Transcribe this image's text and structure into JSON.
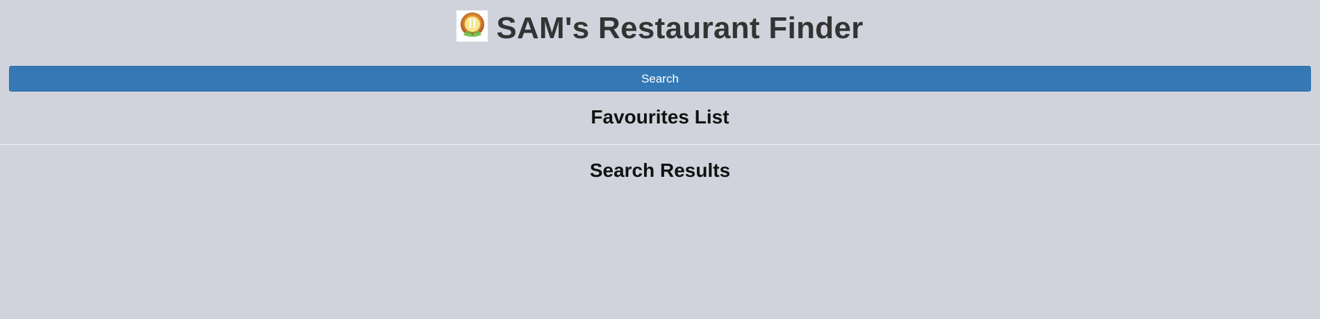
{
  "app": {
    "title": "SAM's Restaurant Finder",
    "logo_icon": "restaurant-logo-icon"
  },
  "search": {
    "button_label": "Search"
  },
  "sections": {
    "favourites_heading": "Favourites List",
    "results_heading": "Search Results"
  },
  "colors": {
    "background": "#d0d3db",
    "button": "#3479b6",
    "title": "#333333"
  }
}
